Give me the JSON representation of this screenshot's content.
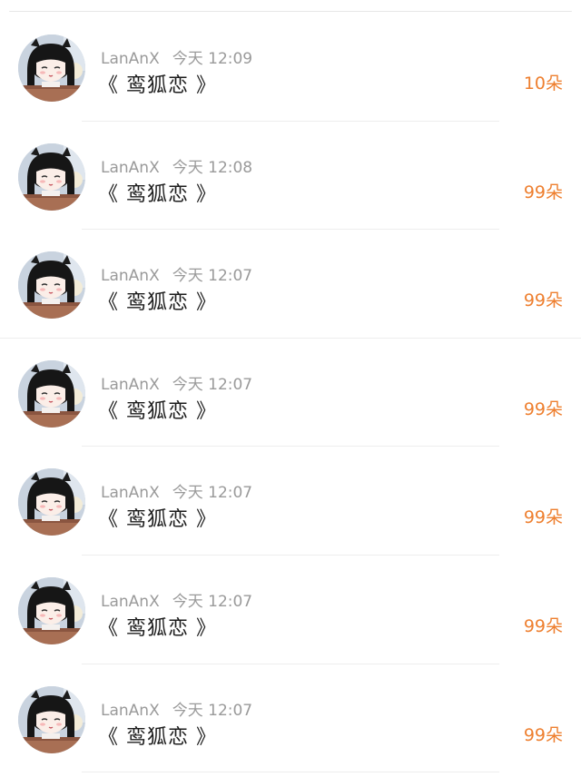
{
  "gifts": [
    {
      "user": "LanAnX",
      "time": "今天 12:09",
      "title": "《 鸾狐恋 》",
      "amount": "10朵"
    },
    {
      "user": "LanAnX",
      "time": "今天 12:08",
      "title": "《 鸾狐恋 》",
      "amount": "99朵"
    },
    {
      "user": "LanAnX",
      "time": "今天 12:07",
      "title": "《 鸾狐恋 》",
      "amount": "99朵"
    },
    {
      "user": "LanAnX",
      "time": "今天 12:07",
      "title": "《 鸾狐恋 》",
      "amount": "99朵"
    },
    {
      "user": "LanAnX",
      "time": "今天 12:07",
      "title": "《 鸾狐恋 》",
      "amount": "99朵"
    },
    {
      "user": "LanAnX",
      "time": "今天 12:07",
      "title": "《 鸾狐恋 》",
      "amount": "99朵"
    },
    {
      "user": "LanAnX",
      "time": "今天 12:07",
      "title": "《 鸾狐恋 》",
      "amount": "99朵"
    }
  ],
  "colors": {
    "accent": "#ee7f2f",
    "username": "#9a9a9a",
    "title": "#1c1c1c"
  }
}
